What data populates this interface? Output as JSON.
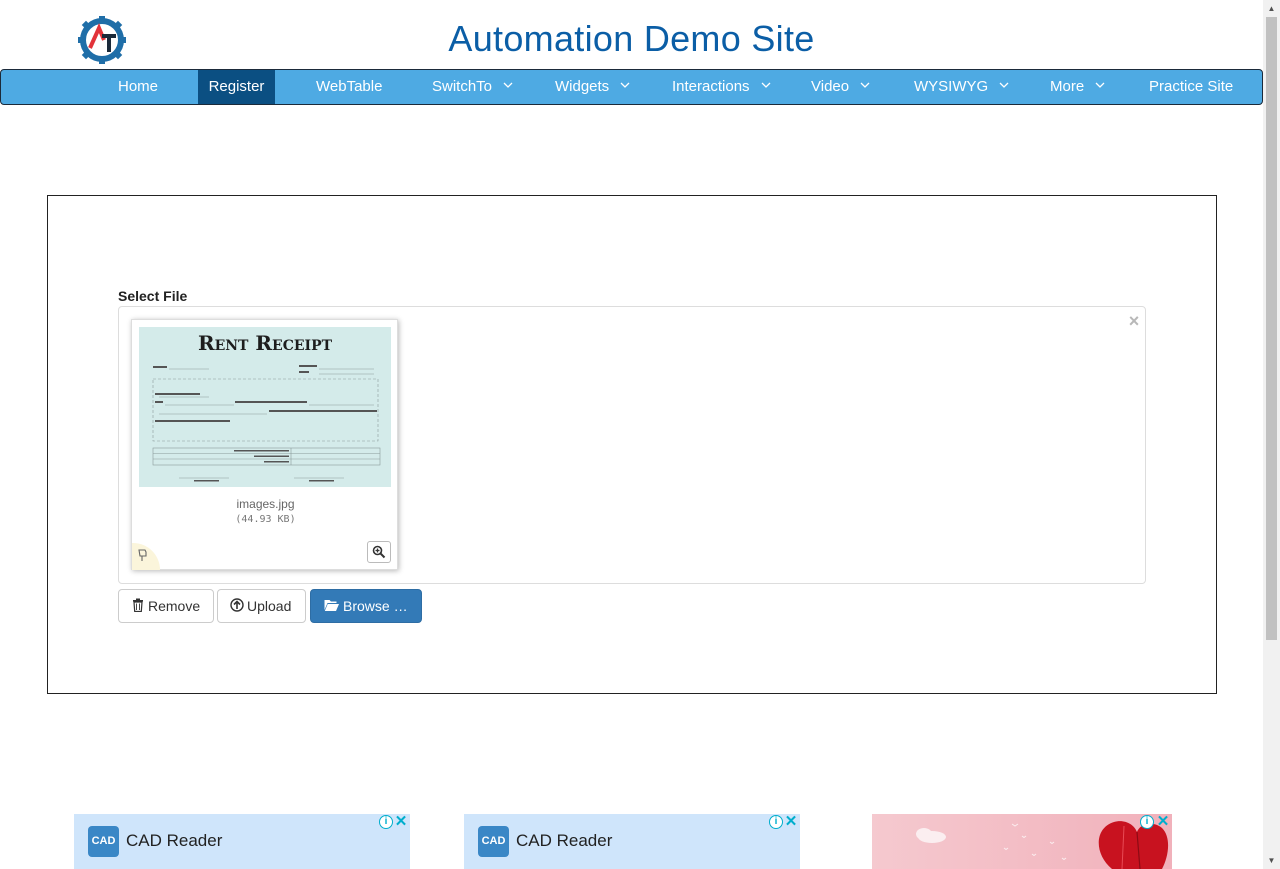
{
  "header": {
    "site_title": "Automation Demo Site",
    "logo_icon": "gear-at-logo-icon"
  },
  "nav": {
    "items": [
      {
        "label": "Home",
        "dropdown": false,
        "active": false
      },
      {
        "label": "Register",
        "dropdown": false,
        "active": true
      },
      {
        "label": "WebTable",
        "dropdown": false,
        "active": false
      },
      {
        "label": "SwitchTo",
        "dropdown": true,
        "active": false
      },
      {
        "label": "Widgets",
        "dropdown": true,
        "active": false
      },
      {
        "label": "Interactions",
        "dropdown": true,
        "active": false
      },
      {
        "label": "Video",
        "dropdown": true,
        "active": false
      },
      {
        "label": "WYSIWYG",
        "dropdown": true,
        "active": false
      },
      {
        "label": "More",
        "dropdown": true,
        "active": false
      },
      {
        "label": "Practice Site",
        "dropdown": false,
        "active": false
      }
    ],
    "bar_color": "#4eaae3",
    "active_color": "#0b4f82"
  },
  "upload": {
    "label": "Select File",
    "close_symbol": "×",
    "preview": {
      "image_heading": "Rent Receipt",
      "file_name": "images.jpg",
      "file_size": "(44.93 KB)"
    },
    "buttons": {
      "remove": "Remove",
      "upload": "Upload",
      "browse": "Browse …"
    },
    "browse_color": "#337ab7"
  },
  "ads": [
    {
      "text": "CAD Reader",
      "logo_text": "CAD"
    },
    {
      "text": "CAD Reader",
      "logo_text": "CAD"
    }
  ],
  "ad_info_symbol": "i",
  "ad_close_symbol": "✕"
}
